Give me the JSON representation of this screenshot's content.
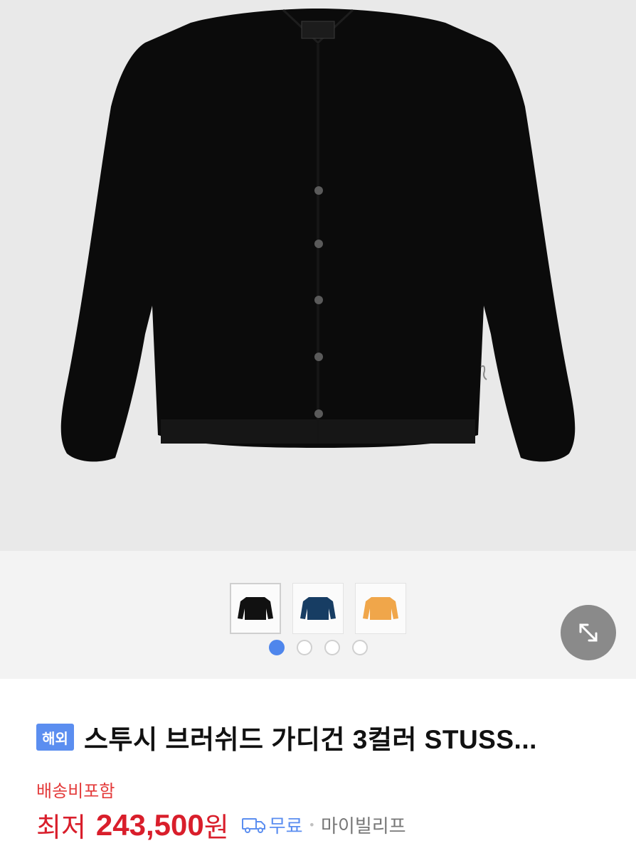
{
  "product": {
    "badge": "해외",
    "title": "스투시 브러쉬드 가디건 3컬러 STUSS...",
    "shipping_note": "배송비포함",
    "price_label": "최저",
    "price_value": "243,500",
    "price_unit": "원",
    "delivery": "무료",
    "separator": "•",
    "seller": "마이빌리프"
  },
  "gallery": {
    "main_image": "black-cardigan-photo",
    "thumbnails": [
      {
        "color": "#111111",
        "name": "black-cardigan-thumbnail"
      },
      {
        "color": "#173d63",
        "name": "navy-cardigan-thumbnail"
      },
      {
        "color": "#f0a64a",
        "name": "orange-cardigan-thumbnail"
      }
    ],
    "page_count": 4,
    "active_page": 1
  },
  "colors": {
    "accent": "#4f86ec",
    "price": "#d91e2b",
    "badge": "#5b8ef0"
  },
  "icons": {
    "expand": "expand-diagonal-icon",
    "delivery": "truck-icon"
  }
}
